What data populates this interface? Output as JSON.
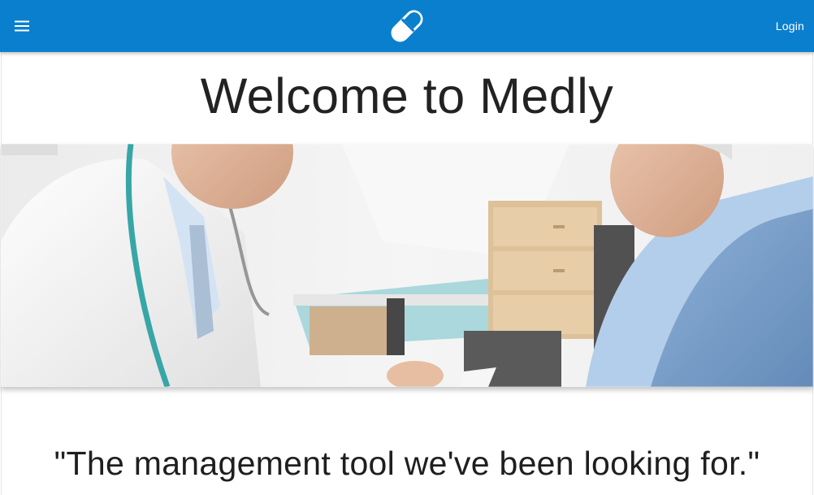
{
  "header": {
    "menu_icon": "hamburger-menu-icon",
    "logo_icon": "pill-capsule-icon",
    "login_label": "Login",
    "bar_color": "#0a7fce"
  },
  "main": {
    "title": "Welcome to Medly",
    "hero_image": "doctor-patient-consultation-photo",
    "quote": "\"The management tool we've been looking for.\""
  }
}
